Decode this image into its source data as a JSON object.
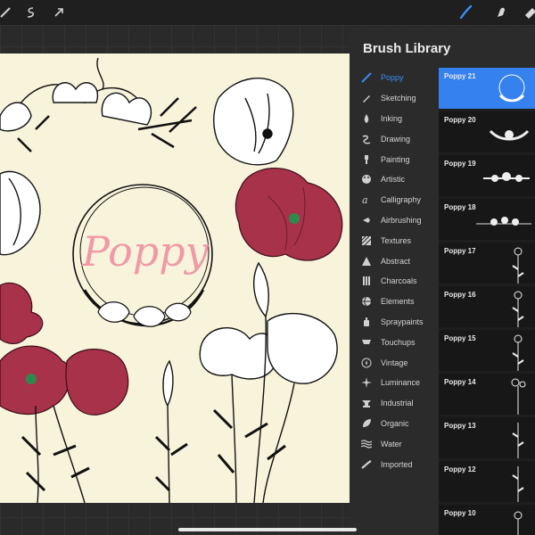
{
  "panel": {
    "title": "Brush Library"
  },
  "categories": [
    {
      "label": "Poppy",
      "icon": "poppy-brush-icon",
      "selected": true
    },
    {
      "label": "Sketching",
      "icon": "pencil-icon"
    },
    {
      "label": "Inking",
      "icon": "ink-drop-icon"
    },
    {
      "label": "Drawing",
      "icon": "squiggle-icon"
    },
    {
      "label": "Painting",
      "icon": "paintbrush-icon"
    },
    {
      "label": "Artistic",
      "icon": "palette-icon"
    },
    {
      "label": "Calligraphy",
      "icon": "calligraphy-icon"
    },
    {
      "label": "Airbrushing",
      "icon": "airbrush-icon"
    },
    {
      "label": "Textures",
      "icon": "texture-icon"
    },
    {
      "label": "Abstract",
      "icon": "triangle-icon"
    },
    {
      "label": "Charcoals",
      "icon": "charcoal-icon"
    },
    {
      "label": "Elements",
      "icon": "globe-icon"
    },
    {
      "label": "Spraypaints",
      "icon": "spraycan-icon"
    },
    {
      "label": "Touchups",
      "icon": "touchup-icon"
    },
    {
      "label": "Vintage",
      "icon": "star-badge-icon"
    },
    {
      "label": "Luminance",
      "icon": "sparkle-icon"
    },
    {
      "label": "Industrial",
      "icon": "anvil-icon"
    },
    {
      "label": "Organic",
      "icon": "leaf-icon"
    },
    {
      "label": "Water",
      "icon": "waves-icon"
    },
    {
      "label": "Imported",
      "icon": "imported-stroke-icon"
    }
  ],
  "brushes": [
    {
      "name": "Poppy 21",
      "preview": "wreath-icon",
      "selected": true
    },
    {
      "name": "Poppy 20",
      "preview": "floral-swag-icon"
    },
    {
      "name": "Poppy 19",
      "preview": "floral-border-icon"
    },
    {
      "name": "Poppy 18",
      "preview": "floral-divider-icon"
    },
    {
      "name": "Poppy 17",
      "preview": "poppy-stem-icon"
    },
    {
      "name": "Poppy 16",
      "preview": "poppy-stem-icon"
    },
    {
      "name": "Poppy 15",
      "preview": "poppy-stem-icon"
    },
    {
      "name": "Poppy 14",
      "preview": "poppy-stem-icon"
    },
    {
      "name": "Poppy 13",
      "preview": "poppy-stem-icon"
    },
    {
      "name": "Poppy 12",
      "preview": "poppy-stem-icon"
    },
    {
      "name": "Poppy 10",
      "preview": "poppy-stem-icon"
    }
  ],
  "canvas": {
    "wreath_text": "Poppy"
  },
  "colors": {
    "accent": "#3581ee",
    "poppy_red": "#a8324a",
    "paper": "#f8f4dc",
    "wreath_text": "#ef9aa6"
  }
}
